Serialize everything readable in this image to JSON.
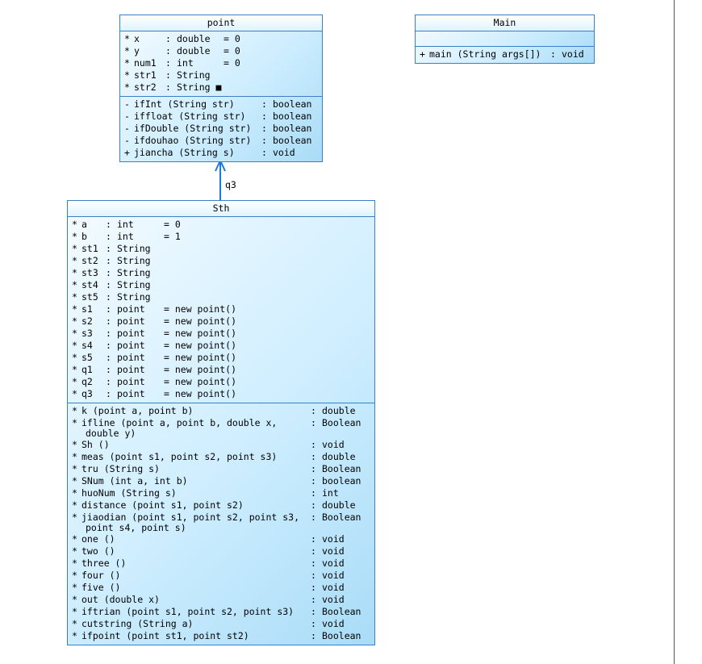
{
  "diagram": {
    "classes": {
      "point": {
        "name": "point",
        "attributes": [
          {
            "vis": "*",
            "name": "x",
            "type": "double",
            "init": "= 0"
          },
          {
            "vis": "*",
            "name": "y",
            "type": "double",
            "init": "= 0"
          },
          {
            "vis": "*",
            "name": "num1",
            "type": "int",
            "init": "= 0"
          },
          {
            "vis": "*",
            "name": "str1",
            "type": "String",
            "init": ""
          },
          {
            "vis": "*",
            "name": "str2",
            "type": "String ■",
            "init": ""
          }
        ],
        "methods": [
          {
            "vis": "-",
            "sig": "ifInt (String str)",
            "ret": "boolean"
          },
          {
            "vis": "-",
            "sig": "iffloat (String str)",
            "ret": "boolean"
          },
          {
            "vis": "-",
            "sig": "ifDouble (String str)",
            "ret": "boolean"
          },
          {
            "vis": "-",
            "sig": "ifdouhao (String str)",
            "ret": "boolean"
          },
          {
            "vis": "+",
            "sig": "jiancha (String s)",
            "ret": "void"
          }
        ]
      },
      "main": {
        "name": "Main",
        "methods": [
          {
            "vis": "+",
            "sig": "main (String args[])",
            "ret": "void"
          }
        ]
      },
      "sth": {
        "name": "Sth",
        "attributes": [
          {
            "vis": "*",
            "name": "a",
            "type": "int",
            "init": "= 0"
          },
          {
            "vis": "*",
            "name": "b",
            "type": "int",
            "init": "= 1"
          },
          {
            "vis": "*",
            "name": "st1",
            "type": "String",
            "init": ""
          },
          {
            "vis": "*",
            "name": "st2",
            "type": "String",
            "init": ""
          },
          {
            "vis": "*",
            "name": "st3",
            "type": "String",
            "init": ""
          },
          {
            "vis": "*",
            "name": "st4",
            "type": "String",
            "init": ""
          },
          {
            "vis": "*",
            "name": "st5",
            "type": "String",
            "init": ""
          },
          {
            "vis": "*",
            "name": "s1",
            "type": "point",
            "init": "= new point()"
          },
          {
            "vis": "*",
            "name": "s2",
            "type": "point",
            "init": "= new point()"
          },
          {
            "vis": "*",
            "name": "s3",
            "type": "point",
            "init": "= new point()"
          },
          {
            "vis": "*",
            "name": "s4",
            "type": "point",
            "init": "= new point()"
          },
          {
            "vis": "*",
            "name": "s5",
            "type": "point",
            "init": "= new point()"
          },
          {
            "vis": "*",
            "name": "q1",
            "type": "point",
            "init": "= new point()"
          },
          {
            "vis": "*",
            "name": "q2",
            "type": "point",
            "init": "= new point()"
          },
          {
            "vis": "*",
            "name": "q3",
            "type": "point",
            "init": "= new point()"
          }
        ],
        "methods": [
          {
            "vis": "*",
            "sig": "k (point a, point b)",
            "ret": "double"
          },
          {
            "vis": "*",
            "sig": "ifline (point a, point b, double x,",
            "cont": "double y)",
            "ret": "Boolean"
          },
          {
            "vis": "*",
            "sig": "Sh ()",
            "ret": "void"
          },
          {
            "vis": "*",
            "sig": "meas (point s1, point s2, point s3)",
            "ret": "double"
          },
          {
            "vis": "*",
            "sig": "tru (String s)",
            "ret": "Boolean"
          },
          {
            "vis": "*",
            "sig": "SNum (int a, int b)",
            "ret": "boolean"
          },
          {
            "vis": "*",
            "sig": "huoNum (String s)",
            "ret": "int"
          },
          {
            "vis": "*",
            "sig": "distance (point s1, point s2)",
            "ret": "double"
          },
          {
            "vis": "*",
            "sig": "jiaodian (point s1, point s2, point s3,",
            "cont": "point s4, point s)",
            "ret": "Boolean"
          },
          {
            "vis": "*",
            "sig": "one ()",
            "ret": "void"
          },
          {
            "vis": "*",
            "sig": "two ()",
            "ret": "void"
          },
          {
            "vis": "*",
            "sig": "three ()",
            "ret": "void"
          },
          {
            "vis": "*",
            "sig": "four ()",
            "ret": "void"
          },
          {
            "vis": "*",
            "sig": "five ()",
            "ret": "void"
          },
          {
            "vis": "*",
            "sig": "out (double x)",
            "ret": "void"
          },
          {
            "vis": "*",
            "sig": "iftrian (point s1, point s2, point s3)",
            "ret": "Boolean"
          },
          {
            "vis": "*",
            "sig": "cutstring (String a)",
            "ret": "void"
          },
          {
            "vis": "*",
            "sig": "ifpoint (point st1, point st2)",
            "ret": "Boolean"
          }
        ]
      }
    },
    "association": {
      "label": "q3",
      "color": "#1e78d6"
    },
    "colors": {
      "border": "#3d7fc4",
      "fill_light": "#f4fbff",
      "fill_dark": "#a9dcf7"
    }
  }
}
